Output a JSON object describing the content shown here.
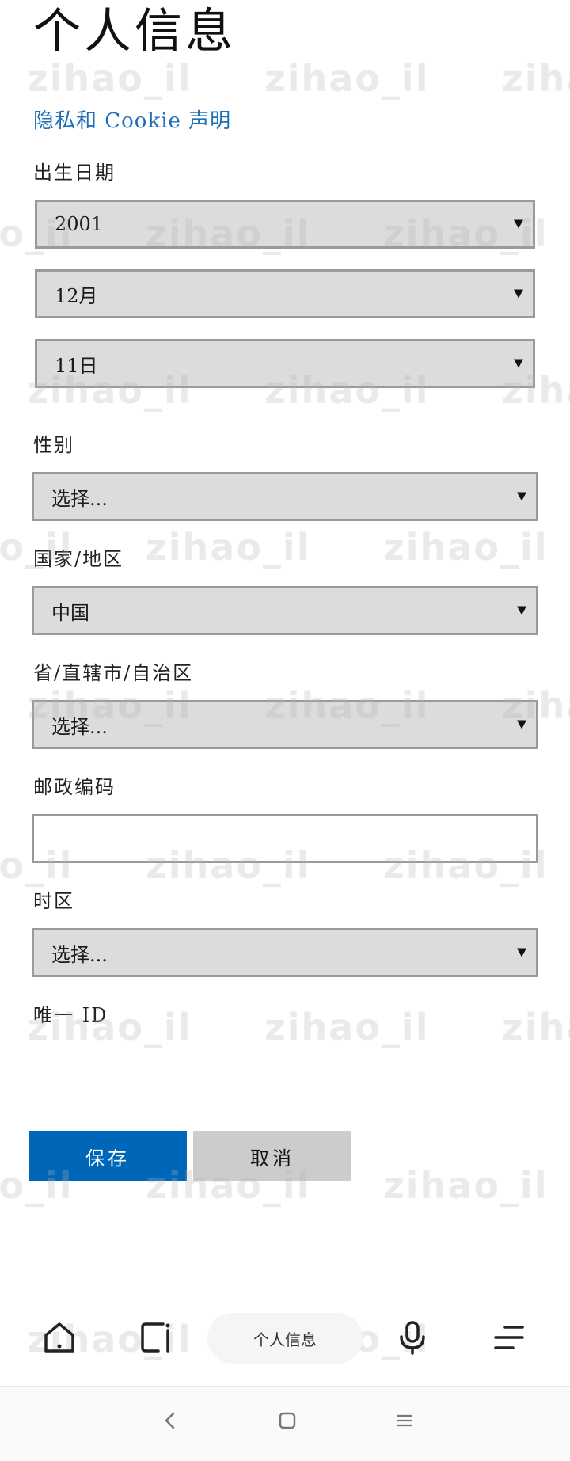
{
  "page": {
    "title": "个人信息",
    "privacy_link": "隐私和 Cookie 声明"
  },
  "form": {
    "dob_label": "出生日期",
    "dob_year": "2001",
    "dob_month": "12月",
    "dob_day": "11日",
    "gender_label": "性别",
    "gender_value": "选择...",
    "country_label": "国家/地区",
    "country_value": "中国",
    "province_label": "省/直辖市/自治区",
    "province_value": "选择...",
    "postal_label": "邮政编码",
    "postal_value": "",
    "timezone_label": "时区",
    "timezone_value": "选择...",
    "unique_id_label": "唯一 ID"
  },
  "buttons": {
    "save": "保存",
    "cancel": "取消"
  },
  "browser": {
    "address_text": "个人信息",
    "icons": [
      "home-icon",
      "tabs-icon",
      "microphone-icon",
      "menu-icon"
    ]
  },
  "system_nav": {
    "icons": [
      "back-icon",
      "home-square-icon",
      "recents-icon"
    ]
  },
  "watermark": {
    "text": "zihao_il",
    "color": "#b4b4b4"
  },
  "colors": {
    "accent": "#0067b8",
    "link": "#1f6fb8",
    "select_bg": "#dcdcdc",
    "border": "#9a9a9a",
    "cancel_bg": "#cccccc"
  }
}
